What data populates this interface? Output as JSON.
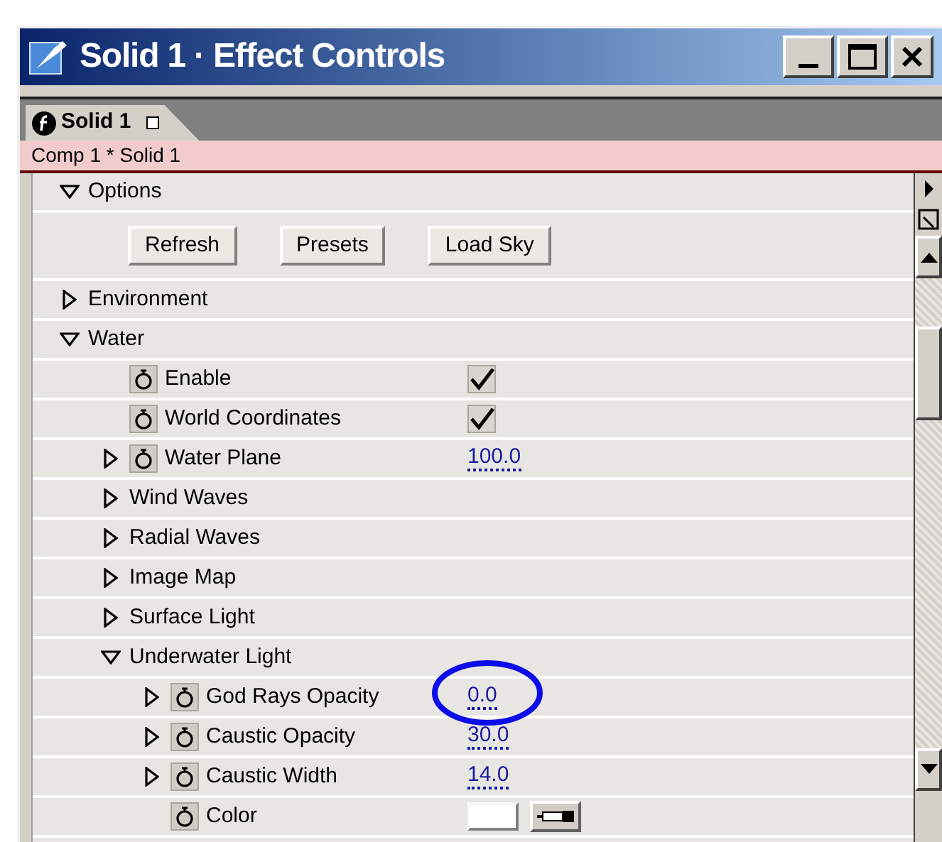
{
  "window": {
    "title": "Solid 1 · Effect Controls"
  },
  "tabs": [
    {
      "label": "Solid 1",
      "selected": true
    }
  ],
  "breadcrumb": "Comp 1 * Solid 1",
  "properties": [
    {
      "kind": "group",
      "label": "Options",
      "expanded": true,
      "children": [
        {
          "kind": "buttons",
          "buttons": [
            "Refresh",
            "Presets",
            "Load Sky"
          ]
        }
      ]
    },
    {
      "kind": "group",
      "label": "Environment",
      "expanded": false
    },
    {
      "kind": "group",
      "label": "Water",
      "expanded": true,
      "children": [
        {
          "kind": "checkbox",
          "label": "Enable",
          "checked": true
        },
        {
          "kind": "checkbox",
          "label": "World Coordinates",
          "checked": true
        },
        {
          "kind": "number",
          "label": "Water Plane",
          "value": "100.0",
          "expanded": false
        },
        {
          "kind": "group",
          "label": "Wind Waves",
          "expanded": false
        },
        {
          "kind": "group",
          "label": "Radial Waves",
          "expanded": false
        },
        {
          "kind": "group",
          "label": "Image Map",
          "expanded": false
        },
        {
          "kind": "group",
          "label": "Surface Light",
          "expanded": false
        },
        {
          "kind": "group",
          "label": "Underwater Light",
          "expanded": true,
          "children": [
            {
              "kind": "number",
              "label": "God Rays Opacity",
              "value": "0.0",
              "expanded": false
            },
            {
              "kind": "number",
              "label": "Caustic Opacity",
              "value": "30.0",
              "expanded": false
            },
            {
              "kind": "number",
              "label": "Caustic Width",
              "value": "14.0",
              "expanded": false
            },
            {
              "kind": "color",
              "label": "Color"
            }
          ]
        }
      ]
    }
  ]
}
